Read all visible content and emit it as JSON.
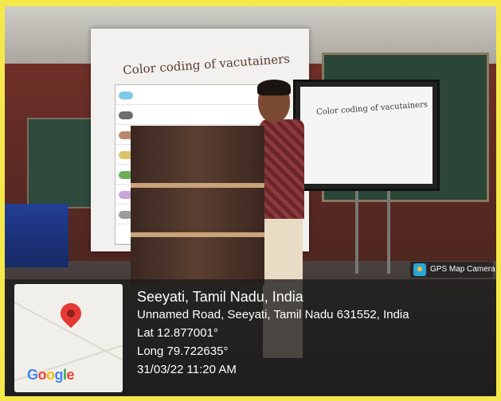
{
  "scene": {
    "slide_title": "Color coding of vacutainers",
    "monitor_title": "Color coding of vacutainers"
  },
  "badge": {
    "label": "GPS Map Camera",
    "icon": "camera-pin-icon"
  },
  "map": {
    "logo_text": "Google",
    "pin_icon": "map-pin-icon"
  },
  "location": {
    "place": "Seeyati, Tamil Nadu, India",
    "address": "Unnamed Road, Seeyati, Tamil Nadu 631552, India",
    "lat": "Lat 12.877001°",
    "long": "Long 79.722635°",
    "datetime": "31/03/22 11:20 AM"
  },
  "colors": {
    "border": "#f4e84a",
    "overlay": "#1c1c1c",
    "pin": "#e53935"
  }
}
